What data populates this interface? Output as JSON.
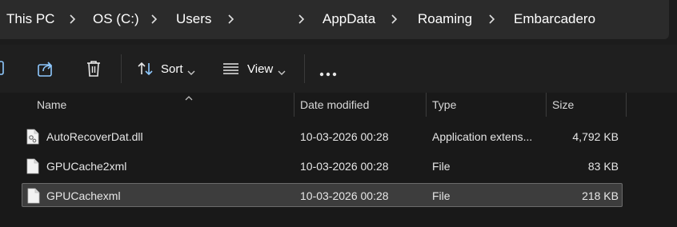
{
  "breadcrumb": {
    "items": [
      "This PC",
      "OS (C:)",
      "Users",
      "AppData",
      "Roaming",
      "Embarcadero"
    ]
  },
  "toolbar": {
    "sort_label": "Sort",
    "view_label": "View",
    "more_label": "•••",
    "icons": [
      "copy-icon",
      "share-icon",
      "delete-icon",
      "sort-icon",
      "view-icon",
      "more-icon"
    ]
  },
  "columns": {
    "name": "Name",
    "date": "Date modified",
    "type": "Type",
    "size": "Size"
  },
  "files": [
    {
      "name": "AutoRecoverDat.dll",
      "date": "10-03-2026 00:28",
      "type": "Application extens...",
      "size": "4,792 KB",
      "icon": "dll-file-icon"
    },
    {
      "name": "GPUCache2xml",
      "date": "10-03-2026 00:28",
      "type": "File",
      "size": "83 KB",
      "icon": "file-icon"
    },
    {
      "name": "GPUCachexml",
      "date": "10-03-2026 00:28",
      "type": "File",
      "size": "218 KB",
      "icon": "file-icon",
      "selected": true
    }
  ],
  "colors": {
    "background": "#1c1c1c",
    "address_bar": "#2b2b2b",
    "selection": "#3d3d3d",
    "accent_icon": "#8fc9ff"
  }
}
